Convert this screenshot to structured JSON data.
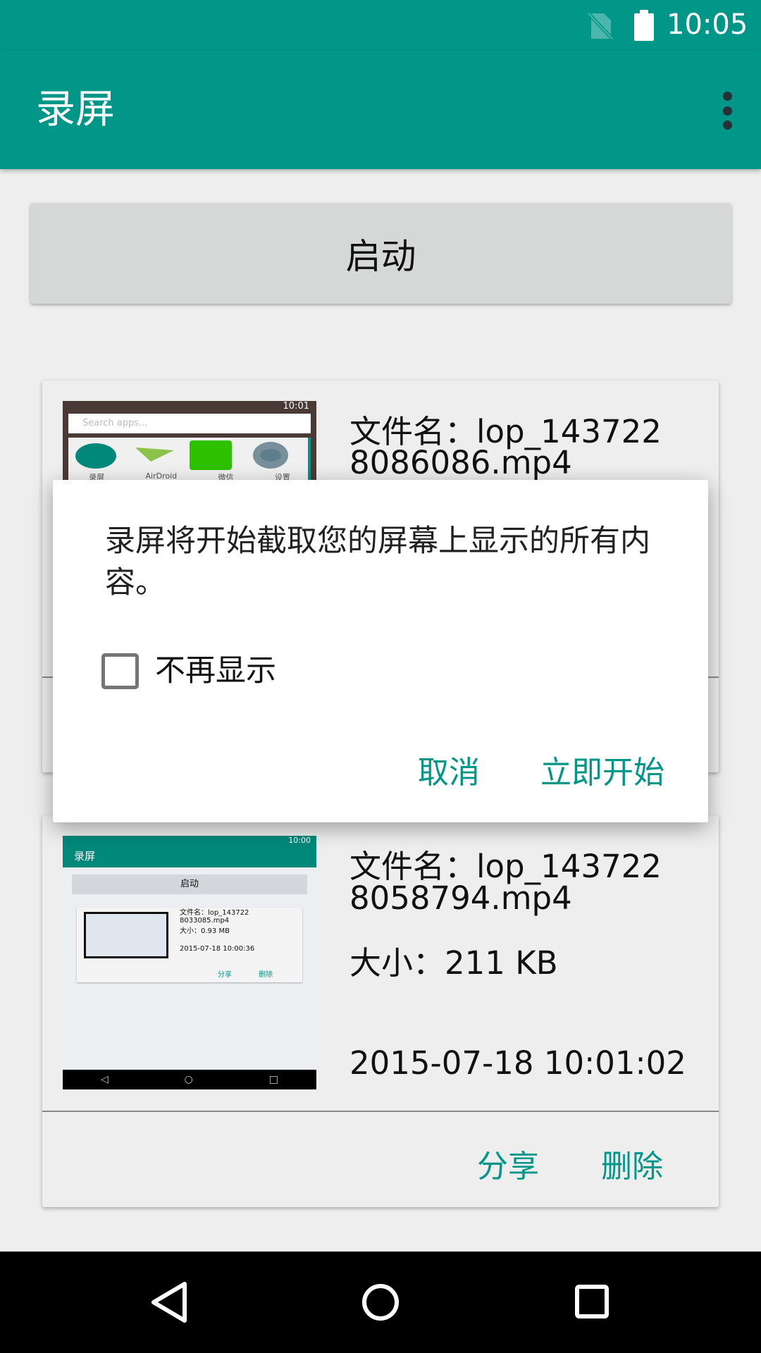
{
  "status_bar": {
    "time": "10:05",
    "icons": [
      "no-sim-icon",
      "battery-full-icon"
    ]
  },
  "toolbar": {
    "title": "录屏",
    "menu_icon": "more-vert-icon"
  },
  "start_button": {
    "label": "启动"
  },
  "recordings": [
    {
      "filename_line1": "文件名：lop_143722",
      "filename_line2": "8086086.mp4",
      "thumbnail": {
        "time": "10:01",
        "search_placeholder": "Search apps...",
        "apps": [
          "录屏",
          "AirDroid",
          "微信",
          "设置"
        ]
      }
    },
    {
      "filename_line1": "文件名：lop_143722",
      "filename_line2": "8058794.mp4",
      "size": "大小：211 KB",
      "date": "2015-07-18 10:01:02",
      "share_label": "分享",
      "delete_label": "删除",
      "thumbnail": {
        "time": "10:00",
        "title": "录屏",
        "start_label": "启动",
        "file_line1": "文件名：lop_143722",
        "file_line2": "8033085.mp4",
        "size": "大小：0.93 MB",
        "date": "2015-07-18 10:00:36",
        "share_label": "分享",
        "delete_label": "删除"
      }
    }
  ],
  "dialog": {
    "message": "录屏将开始截取您的屏幕上显示的所有内容。",
    "checkbox_label": "不再显示",
    "checkbox_checked": false,
    "cancel_label": "取消",
    "confirm_label": "立即开始"
  },
  "colors": {
    "primary": "#009688",
    "accent": "#009688"
  }
}
